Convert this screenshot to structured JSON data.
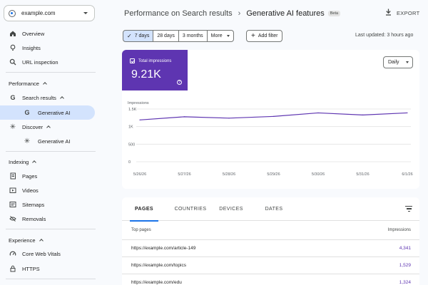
{
  "property": {
    "name": "example.com"
  },
  "sidebar": {
    "top_items": [
      {
        "label": "Overview",
        "icon": "home-icon"
      },
      {
        "label": "Insights",
        "icon": "lightbulb-icon"
      },
      {
        "label": "URL inspection",
        "icon": "search-icon"
      }
    ],
    "performance": {
      "title": "Performance",
      "search_results": "Search results",
      "search_sub": "Generative AI",
      "discover": "Discover",
      "discover_sub": "Generative AI"
    },
    "indexing": {
      "title": "Indexing",
      "items": [
        {
          "label": "Pages",
          "icon": "pages-icon"
        },
        {
          "label": "Videos",
          "icon": "video-icon"
        },
        {
          "label": "Sitemaps",
          "icon": "sitemap-icon"
        },
        {
          "label": "Removals",
          "icon": "removal-icon"
        }
      ]
    },
    "experience": {
      "title": "Experience",
      "items": [
        {
          "label": "Core Web Vitals",
          "icon": "speedometer-icon"
        },
        {
          "label": "HTTPS",
          "icon": "lock-icon"
        }
      ]
    }
  },
  "header": {
    "breadcrumb_root": "Performance on Search results",
    "breadcrumb_separator": "›",
    "title": "Generative AI features",
    "badge": "Beta",
    "export_label": "EXPORT"
  },
  "filters": {
    "ranges": [
      "7 days",
      "28 days",
      "3 months"
    ],
    "selected": "7 days",
    "more": "More",
    "add_filter": "Add filter",
    "last_updated": "Last updated: 3 hours ago"
  },
  "metric": {
    "label": "Total impressions",
    "value": "9.21K",
    "color": "#5e35b1"
  },
  "granularity": "Daily",
  "chart_data": {
    "type": "line",
    "ylabel": "Impressions",
    "y_ticks": [
      "0",
      "500",
      "1K",
      "1.5K"
    ],
    "ylim": [
      0,
      1500
    ],
    "grid": true,
    "x": [
      "5/26/26",
      "5/27/26",
      "5/28/26",
      "5/29/26",
      "5/30/26",
      "5/31/26",
      "6/1/26"
    ],
    "series": [
      {
        "values": [
          1190,
          1280,
          1240,
          1290,
          1390,
          1330,
          1390
        ],
        "color": "#5e35b1"
      }
    ]
  },
  "table": {
    "tabs": [
      "PAGES",
      "COUNTRIES",
      "DEVICES",
      "DATES"
    ],
    "active_tab": "PAGES",
    "columns": [
      "Top pages",
      "Impressions"
    ],
    "rows": [
      {
        "url": "https://example.com/article-149",
        "impressions": "4,341"
      },
      {
        "url": "https://example.com/topics",
        "impressions": "1,529"
      },
      {
        "url": "https://example.com/edu",
        "impressions": "1,324"
      }
    ]
  }
}
